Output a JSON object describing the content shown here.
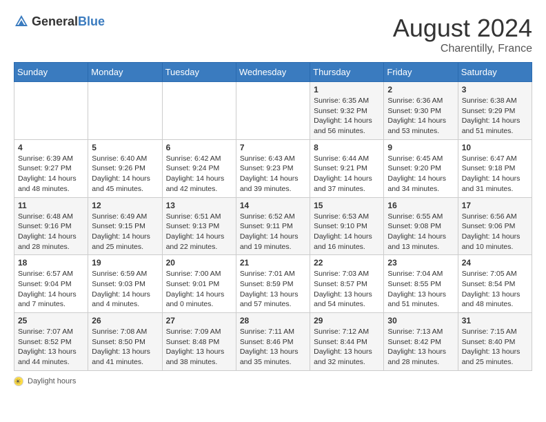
{
  "header": {
    "logo_general": "General",
    "logo_blue": "Blue",
    "month_year": "August 2024",
    "location": "Charentilly, France"
  },
  "legend": {
    "text": "Daylight hours"
  },
  "days_of_week": [
    "Sunday",
    "Monday",
    "Tuesday",
    "Wednesday",
    "Thursday",
    "Friday",
    "Saturday"
  ],
  "weeks": [
    [
      {
        "day": "",
        "info": ""
      },
      {
        "day": "",
        "info": ""
      },
      {
        "day": "",
        "info": ""
      },
      {
        "day": "",
        "info": ""
      },
      {
        "day": "1",
        "info": "Sunrise: 6:35 AM\nSunset: 9:32 PM\nDaylight: 14 hours and 56 minutes."
      },
      {
        "day": "2",
        "info": "Sunrise: 6:36 AM\nSunset: 9:30 PM\nDaylight: 14 hours and 53 minutes."
      },
      {
        "day": "3",
        "info": "Sunrise: 6:38 AM\nSunset: 9:29 PM\nDaylight: 14 hours and 51 minutes."
      }
    ],
    [
      {
        "day": "4",
        "info": "Sunrise: 6:39 AM\nSunset: 9:27 PM\nDaylight: 14 hours and 48 minutes."
      },
      {
        "day": "5",
        "info": "Sunrise: 6:40 AM\nSunset: 9:26 PM\nDaylight: 14 hours and 45 minutes."
      },
      {
        "day": "6",
        "info": "Sunrise: 6:42 AM\nSunset: 9:24 PM\nDaylight: 14 hours and 42 minutes."
      },
      {
        "day": "7",
        "info": "Sunrise: 6:43 AM\nSunset: 9:23 PM\nDaylight: 14 hours and 39 minutes."
      },
      {
        "day": "8",
        "info": "Sunrise: 6:44 AM\nSunset: 9:21 PM\nDaylight: 14 hours and 37 minutes."
      },
      {
        "day": "9",
        "info": "Sunrise: 6:45 AM\nSunset: 9:20 PM\nDaylight: 14 hours and 34 minutes."
      },
      {
        "day": "10",
        "info": "Sunrise: 6:47 AM\nSunset: 9:18 PM\nDaylight: 14 hours and 31 minutes."
      }
    ],
    [
      {
        "day": "11",
        "info": "Sunrise: 6:48 AM\nSunset: 9:16 PM\nDaylight: 14 hours and 28 minutes."
      },
      {
        "day": "12",
        "info": "Sunrise: 6:49 AM\nSunset: 9:15 PM\nDaylight: 14 hours and 25 minutes."
      },
      {
        "day": "13",
        "info": "Sunrise: 6:51 AM\nSunset: 9:13 PM\nDaylight: 14 hours and 22 minutes."
      },
      {
        "day": "14",
        "info": "Sunrise: 6:52 AM\nSunset: 9:11 PM\nDaylight: 14 hours and 19 minutes."
      },
      {
        "day": "15",
        "info": "Sunrise: 6:53 AM\nSunset: 9:10 PM\nDaylight: 14 hours and 16 minutes."
      },
      {
        "day": "16",
        "info": "Sunrise: 6:55 AM\nSunset: 9:08 PM\nDaylight: 14 hours and 13 minutes."
      },
      {
        "day": "17",
        "info": "Sunrise: 6:56 AM\nSunset: 9:06 PM\nDaylight: 14 hours and 10 minutes."
      }
    ],
    [
      {
        "day": "18",
        "info": "Sunrise: 6:57 AM\nSunset: 9:04 PM\nDaylight: 14 hours and 7 minutes."
      },
      {
        "day": "19",
        "info": "Sunrise: 6:59 AM\nSunset: 9:03 PM\nDaylight: 14 hours and 4 minutes."
      },
      {
        "day": "20",
        "info": "Sunrise: 7:00 AM\nSunset: 9:01 PM\nDaylight: 14 hours and 0 minutes."
      },
      {
        "day": "21",
        "info": "Sunrise: 7:01 AM\nSunset: 8:59 PM\nDaylight: 13 hours and 57 minutes."
      },
      {
        "day": "22",
        "info": "Sunrise: 7:03 AM\nSunset: 8:57 PM\nDaylight: 13 hours and 54 minutes."
      },
      {
        "day": "23",
        "info": "Sunrise: 7:04 AM\nSunset: 8:55 PM\nDaylight: 13 hours and 51 minutes."
      },
      {
        "day": "24",
        "info": "Sunrise: 7:05 AM\nSunset: 8:54 PM\nDaylight: 13 hours and 48 minutes."
      }
    ],
    [
      {
        "day": "25",
        "info": "Sunrise: 7:07 AM\nSunset: 8:52 PM\nDaylight: 13 hours and 44 minutes."
      },
      {
        "day": "26",
        "info": "Sunrise: 7:08 AM\nSunset: 8:50 PM\nDaylight: 13 hours and 41 minutes."
      },
      {
        "day": "27",
        "info": "Sunrise: 7:09 AM\nSunset: 8:48 PM\nDaylight: 13 hours and 38 minutes."
      },
      {
        "day": "28",
        "info": "Sunrise: 7:11 AM\nSunset: 8:46 PM\nDaylight: 13 hours and 35 minutes."
      },
      {
        "day": "29",
        "info": "Sunrise: 7:12 AM\nSunset: 8:44 PM\nDaylight: 13 hours and 32 minutes."
      },
      {
        "day": "30",
        "info": "Sunrise: 7:13 AM\nSunset: 8:42 PM\nDaylight: 13 hours and 28 minutes."
      },
      {
        "day": "31",
        "info": "Sunrise: 7:15 AM\nSunset: 8:40 PM\nDaylight: 13 hours and 25 minutes."
      }
    ]
  ]
}
